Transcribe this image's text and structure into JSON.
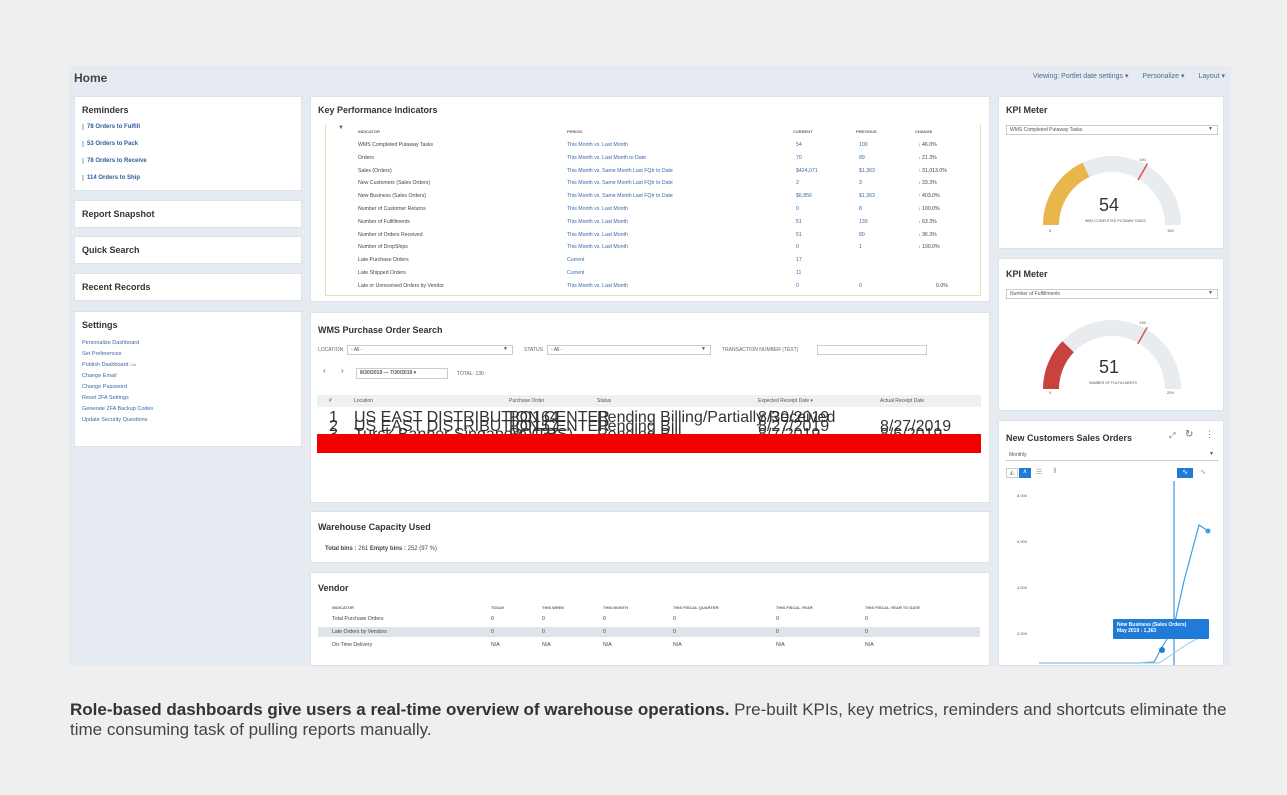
{
  "home": {
    "title": "Home"
  },
  "view_options": [
    "Viewing: Portlet date settings ▾",
    "Personalize ▾",
    "Layout ▾"
  ],
  "reminders": {
    "title": "Reminders",
    "items": [
      {
        "count": "78",
        "label": "Orders to Fulfill"
      },
      {
        "count": "53",
        "label": "Orders to Pack"
      },
      {
        "count": "78",
        "label": "Orders to Receive"
      },
      {
        "count": "114",
        "label": "Orders to Ship"
      }
    ]
  },
  "report_snapshot": {
    "title": "Report Snapshot"
  },
  "quick_search": {
    "title": "Quick Search"
  },
  "recent_records": {
    "title": "Recent Records"
  },
  "settings": {
    "title": "Settings",
    "links": [
      "Personalize Dashboard",
      "Set Preferences",
      "Publish Dashboard",
      "Change Email",
      "Change Password",
      "Reset 2FA Settings",
      "Generate 2FA Backup Codes",
      "Update Security Questions"
    ],
    "publish_badge": "List"
  },
  "kpi": {
    "title": "Key Performance Indicators",
    "headers": [
      "INDICATOR",
      "PERIOD",
      "CURRENT",
      "PREVIOUS",
      "CHANGE"
    ],
    "rows": [
      {
        "indicator": "WMS Completed Putaway Tasks",
        "period": "This Month vs. Last Month",
        "current": "54",
        "previous": "100",
        "change": "46.0%",
        "dir": "down"
      },
      {
        "indicator": "Orders",
        "period": "This Month vs. Last Month to Date",
        "current": "70",
        "previous": "89",
        "change": "21.3%",
        "dir": "down"
      },
      {
        "indicator": "Sales (Orders)",
        "period": "This Month vs. Same Month Last FQtr to Date",
        "current": "$424,071",
        "previous": "$1,363",
        "change": "31,013.0%",
        "dir": "up"
      },
      {
        "indicator": "New Customers (Sales Orders)",
        "period": "This Month vs. Same Month Last FQtr to Date",
        "current": "2",
        "previous": "3",
        "change": "33.3%",
        "dir": "down"
      },
      {
        "indicator": "New Business (Sales Orders)",
        "period": "This Month vs. Same Month Last FQtr to Date",
        "current": "$6,856",
        "previous": "$1,363",
        "change": "403.0%",
        "dir": "up"
      },
      {
        "indicator": "Number of Customer Returns",
        "period": "This Month vs. Last Month",
        "current": "0",
        "previous": "8",
        "change": "100.0%",
        "dir": "down"
      },
      {
        "indicator": "Number of Fulfillments",
        "period": "This Month vs. Last Month",
        "current": "51",
        "previous": "139",
        "change": "63.3%",
        "dir": "down"
      },
      {
        "indicator": "Number of Orders Received",
        "period": "This Month vs. Last Month",
        "current": "51",
        "previous": "80",
        "change": "36.3%",
        "dir": "down"
      },
      {
        "indicator": "Number of DropShips",
        "period": "This Month vs. Last Month",
        "current": "0",
        "previous": "1",
        "change": "100.0%",
        "dir": "down"
      },
      {
        "indicator": "Late Purchase Orders",
        "period": "Current",
        "current": "17",
        "previous": "",
        "change": "",
        "dir": ""
      },
      {
        "indicator": "Late Shipped Orders",
        "period": "Current",
        "current": "11",
        "previous": "",
        "change": "",
        "dir": ""
      },
      {
        "indicator": "Late or Unreceived Orders by Vendor",
        "period": "This Month vs. Last Month",
        "current": "0",
        "previous": "0",
        "change": "0.0%",
        "dir": ""
      }
    ]
  },
  "wms_search": {
    "title": "WMS Purchase Order Search",
    "location_label": "LOCATION",
    "location_value": "- All -",
    "status_label": "STATUS",
    "status_value": "- All -",
    "txn_label": "TRANSACTION NUMBER (TEXT)",
    "date_range": "8/30/2019 — 7/30/2019 ▾",
    "total_label": "TOTAL:",
    "total_value": "130",
    "headers": [
      "#",
      "Location",
      "Purchase Order",
      "Status",
      "Expected Receipt Date ▾",
      "Actual Receipt Date"
    ],
    "rows": [
      {
        "n": "1",
        "location": "US EAST DISTRIBUTION CENTER",
        "po": "PO164",
        "status": "Pending Billing/Partially Received",
        "expected": "8/30/2019",
        "actual": ""
      },
      {
        "n": "2",
        "location": "US EAST DISTRIBUTION CENTER",
        "po": "PO157",
        "status": "Pending Bill",
        "expected": "8/27/2019",
        "actual": "8/27/2019"
      },
      {
        "n": "3",
        "location": "Turck Banner Singapore (TBS)",
        "po": "PO137",
        "status": "Pending Bill",
        "expected": "8/7/2019",
        "actual": "8/6/2019"
      }
    ]
  },
  "warehouse": {
    "title": "Warehouse Capacity Used",
    "total_label": "Total bins :",
    "total_value": "261",
    "empty_label": "Empty bins :",
    "empty_value": "252 (97 %)"
  },
  "vendor": {
    "title": "Vendor",
    "headers": [
      "INDICATOR",
      "TODAY",
      "THIS WEEK",
      "THIS MONTH",
      "THIS FISCAL QUARTER",
      "THIS FISCAL YEAR",
      "THIS FISCAL YEAR TO DATE"
    ],
    "rows": [
      [
        "Total Purchase Orders",
        "0",
        "0",
        "0",
        "0",
        "0",
        "0"
      ],
      [
        "Late Orders by Vendors",
        "0",
        "0",
        "0",
        "0",
        "0",
        "0"
      ],
      [
        "On-Time Delivery",
        "N/A",
        "N/A",
        "N/A",
        "N/A",
        "N/A",
        "N/A"
      ]
    ]
  },
  "kpi_meter_1": {
    "title": "KPI Meter",
    "select": "WMS Completed Putaway Tasks",
    "value": "54",
    "label": "WMS COMPLETED PUTAWAY TASKS",
    "min": "0",
    "max": "150",
    "target": "100",
    "color": "#e8b64a"
  },
  "kpi_meter_2": {
    "title": "KPI Meter",
    "select": "Number of Fulfillments",
    "value": "51",
    "label": "NUMBER OF FULFILLMENTS",
    "min": "0",
    "max": "209",
    "target": "139",
    "color": "#c8433d"
  },
  "new_customers": {
    "title": "New Customers Sales Orders",
    "select": "Monthly",
    "tooltip_title": "New Business (Sales Orders)",
    "tooltip_value": "May 2019 : 1,363",
    "y_ticks": [
      "8,000",
      "6,000",
      "4,000",
      "2,000"
    ]
  },
  "caption": {
    "bold": "Role-based dashboards give users a real-time overview of warehouse operations.",
    "rest": " Pre-built KPIs, key metrics, reminders and shortcuts eliminate the time consuming task of pulling reports manually."
  }
}
